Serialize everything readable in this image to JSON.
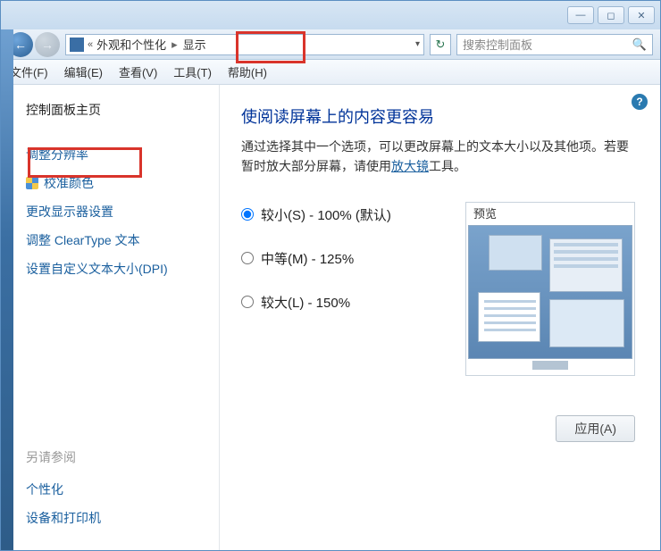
{
  "window": {
    "minimize_glyph": "—",
    "maximize_glyph": "◻",
    "close_glyph": "✕"
  },
  "address": {
    "back_glyph": "←",
    "fwd_glyph": "→",
    "chevrons": "«",
    "crumb1": "外观和个性化",
    "sep": "▸",
    "crumb2": "显示",
    "dropdown_glyph": "▾",
    "refresh_glyph": "↻"
  },
  "search": {
    "placeholder": "搜索控制面板",
    "mag_glyph": "🔍"
  },
  "menu": {
    "file": "文件(F)",
    "edit": "编辑(E)",
    "view": "查看(V)",
    "tools": "工具(T)",
    "help": "帮助(H)"
  },
  "sidebar": {
    "home": "控制面板主页",
    "items": [
      {
        "label": "调整分辨率"
      },
      {
        "label": "校准颜色"
      },
      {
        "label": "更改显示器设置"
      },
      {
        "label": "调整 ClearType 文本"
      },
      {
        "label": "设置自定义文本大小(DPI)"
      }
    ],
    "see_also_header": "另请参阅",
    "see_also": [
      {
        "label": "个性化"
      },
      {
        "label": "设备和打印机"
      }
    ]
  },
  "main": {
    "help_glyph": "?",
    "heading": "使阅读屏幕上的内容更容易",
    "desc_before": "通过选择其中一个选项，可以更改屏幕上的文本大小以及其他项。若要暂时放大部分屏幕，请使用",
    "magnifier_link": "放大镜",
    "desc_after": "工具。",
    "options": [
      {
        "label": "较小(S) - 100% (默认)",
        "checked": true
      },
      {
        "label": "中等(M) - 125%",
        "checked": false
      },
      {
        "label": "较大(L) - 150%",
        "checked": false
      }
    ],
    "preview_label": "预览",
    "apply_label": "应用(A)"
  }
}
